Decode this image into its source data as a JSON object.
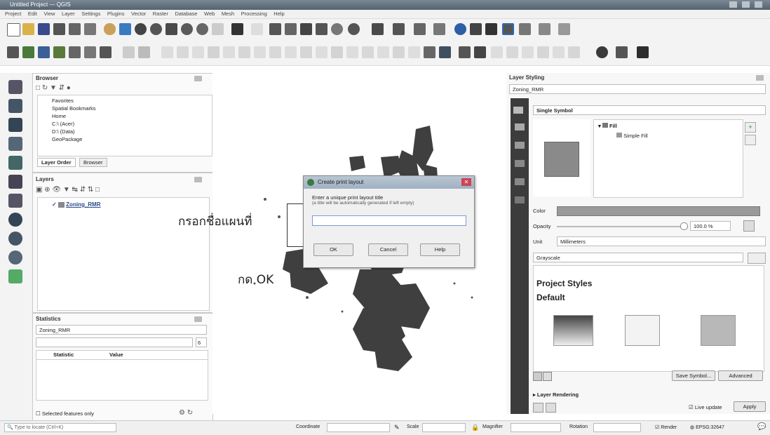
{
  "window": {
    "title": "Untitled Project — QGIS"
  },
  "menu": [
    "Project",
    "Edit",
    "View",
    "Layer",
    "Settings",
    "Plugins",
    "Vector",
    "Raster",
    "Database",
    "Web",
    "Mesh",
    "Processing",
    "Help"
  ],
  "browser": {
    "title": "Browser",
    "items": [
      "Favorites",
      "Spatial Bookmarks",
      "Home",
      "C:\\ (Acer)",
      "D:\\ (Data)",
      "GeoPackage"
    ],
    "tabs": [
      "Layer Order",
      "Browser"
    ]
  },
  "layers": {
    "title": "Layers",
    "layer_name": "Zoning_RMR"
  },
  "statistics": {
    "title": "Statistics",
    "layer": "Zoning_RMR",
    "spin": "6",
    "col_statistic": "Statistic",
    "col_value": "Value",
    "selected_only": "Selected features only"
  },
  "dialog": {
    "title": "Create print layout",
    "prompt": "Enter a unique print layout title",
    "sub": "(a title will be automatically generated if left empty)",
    "value": "",
    "ok": "OK",
    "cancel": "Cancel",
    "help": "Help"
  },
  "annotations": {
    "name_map": "กรอกชื่อแผนที่",
    "press_ok": "กด OK"
  },
  "styling": {
    "title": "Layer Styling",
    "layer": "Zoning_RMR",
    "renderer": "Single Symbol",
    "tree_fill": "Fill",
    "tree_simple": "Simple Fill",
    "color_label": "Color",
    "opacity_label": "Opacity",
    "opacity_value": "100.0 %",
    "unit_label": "Unit",
    "unit_value": "Millimeters",
    "search": "Grayscale",
    "project_styles": "Project Styles",
    "default": "Default",
    "save_symbol": "Save Symbol...",
    "advanced": "Advanced",
    "layer_rendering": "Layer Rendering",
    "live_update": "Live update",
    "apply": "Apply"
  },
  "status": {
    "locate": "Type to locate (Ctrl+K)",
    "coordinate_label": "Coordinate",
    "coordinate": "",
    "scale_label": "Scale",
    "scale": "",
    "magnifier_label": "Magnifier",
    "magnifier": "",
    "rotation_label": "Rotation",
    "rotation": "",
    "render": "Render",
    "epsg": "EPSG:32647"
  },
  "colors": {
    "accent": "#2a6ab8",
    "map": "#3f3f3f",
    "swatch": "#8a8a8a"
  }
}
